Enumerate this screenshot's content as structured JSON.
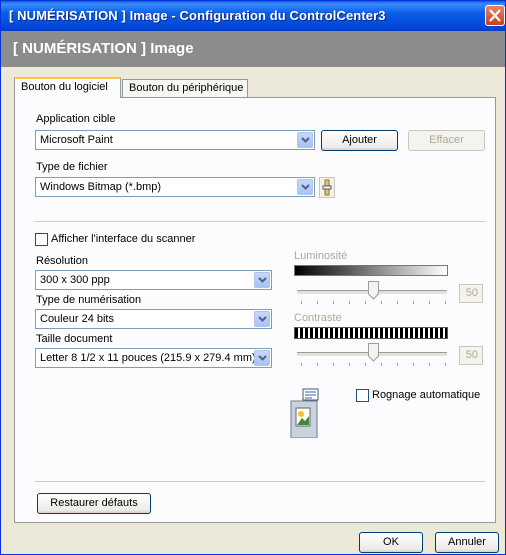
{
  "window": {
    "title": "[ NUMÉRISATION ]  Image - Configuration du ControlCenter3",
    "header": "[ NUMÉRISATION ]  Image"
  },
  "tabs": [
    {
      "label": "Bouton du logiciel",
      "active": true
    },
    {
      "label": "Bouton du périphérique",
      "active": false
    }
  ],
  "target_app": {
    "label": "Application cible",
    "value": "Microsoft Paint",
    "add_label": "Ajouter",
    "delete_label": "Effacer"
  },
  "file_type": {
    "label": "Type de fichier",
    "value": "Windows Bitmap (*.bmp)"
  },
  "scanner_ui": {
    "label": "Afficher l'interface du scanner",
    "checked": false
  },
  "resolution": {
    "label": "Résolution",
    "value": "300 x 300 ppp"
  },
  "scan_type": {
    "label": "Type de numérisation",
    "value": "Couleur 24 bits"
  },
  "doc_size": {
    "label": "Taille document",
    "value": "Letter 8 1/2 x 11 pouces (215.9 x 279.4 mm)"
  },
  "brightness": {
    "label": "Luminosité",
    "value": "50",
    "level": 0.5
  },
  "contrast": {
    "label": "Contraste",
    "value": "50",
    "level": 0.5
  },
  "auto_crop": {
    "label": "Rognage automatique",
    "checked": false
  },
  "buttons": {
    "restore": "Restaurer défauts",
    "ok": "OK",
    "cancel": "Annuler"
  },
  "colors": {
    "titlebar": "#0a5ee8",
    "header": "#8c8c8c",
    "tab_highlight": "#ffc83c",
    "close": "#c7401b"
  }
}
